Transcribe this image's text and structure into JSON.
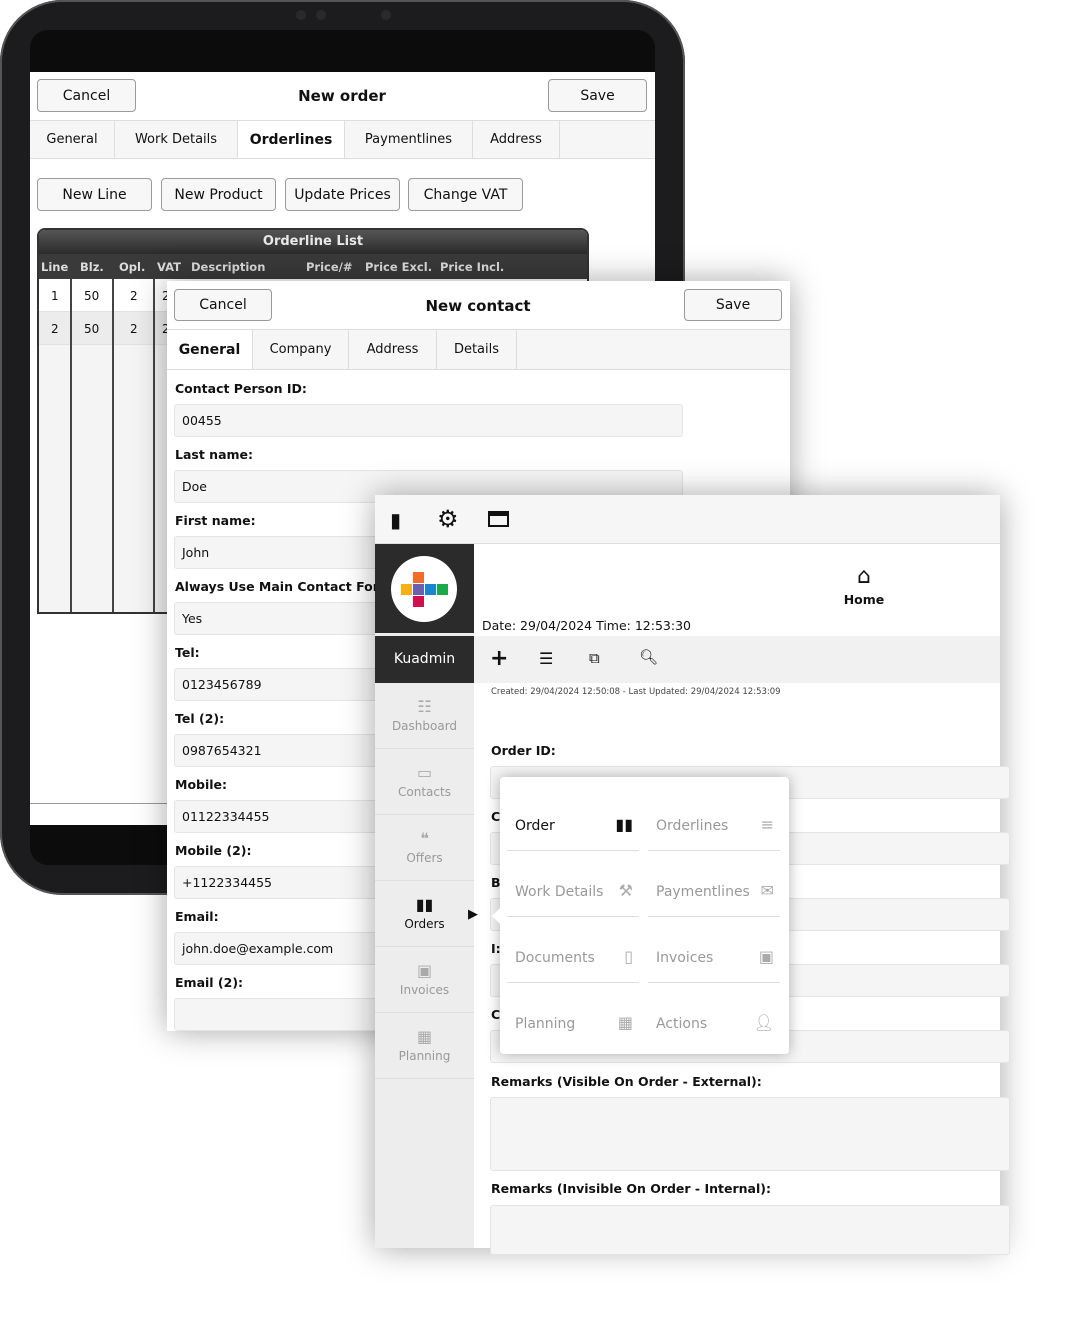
{
  "order": {
    "cancel": "Cancel",
    "title": "New order",
    "save": "Save",
    "tabs": [
      "General",
      "Work Details",
      "Orderlines",
      "Paymentlines",
      "Address"
    ],
    "active_tab": "Orderlines",
    "actions": [
      "New Line",
      "New Product",
      "Update Prices",
      "Change VAT"
    ],
    "table": {
      "title": "Orderline List",
      "columns": [
        "Line",
        "Blz.",
        "Opl.",
        "VAT",
        "Description",
        "Price/#",
        "Price Excl.",
        "Price Incl."
      ],
      "rows": [
        [
          "1",
          "50",
          "2",
          "2"
        ],
        [
          "2",
          "50",
          "2",
          "2"
        ]
      ]
    }
  },
  "contact": {
    "cancel": "Cancel",
    "title": "New contact",
    "save": "Save",
    "tabs": [
      "General",
      "Company",
      "Address",
      "Details"
    ],
    "active_tab": "General",
    "fields": [
      {
        "label": "Contact Person ID:",
        "value": "00455"
      },
      {
        "label": "Last name:",
        "value": "Doe"
      },
      {
        "label": "First name:",
        "value": "John"
      },
      {
        "label": "Always Use Main Contact For O",
        "value": "Yes"
      },
      {
        "label": "Tel:",
        "value": "0123456789"
      },
      {
        "label": "Tel (2):",
        "value": "0987654321"
      },
      {
        "label": "Mobile:",
        "value": "01122334455"
      },
      {
        "label": "Mobile (2):",
        "value": "+1122334455"
      },
      {
        "label": "Email:",
        "value": "john.doe@example.com"
      },
      {
        "label": "Email (2):",
        "value": ""
      }
    ]
  },
  "app": {
    "user": "Kuadmin",
    "home": "Home",
    "datetime": "Date: 29/04/2024 Time: 12:53:30",
    "meta": "Created: 29/04/2024 12:50:08 - Last Updated: 29/04/2024 12:53:09",
    "sidebar": [
      {
        "label": "Dashboard",
        "icon": "list-icon"
      },
      {
        "label": "Contacts",
        "icon": "id-card-icon"
      },
      {
        "label": "Offers",
        "icon": "quote-icon"
      },
      {
        "label": "Orders",
        "icon": "orders-icon",
        "active": true
      },
      {
        "label": "Invoices",
        "icon": "invoice-icon"
      },
      {
        "label": "Planning",
        "icon": "calendar-icon"
      }
    ],
    "labels": [
      "Order ID:",
      "C",
      "B",
      "I:",
      "C"
    ],
    "remarks_external": "Remarks (Visible On Order - External):",
    "remarks_internal": "Remarks (Invisible On Order - Internal):",
    "menu": [
      {
        "label": "Order",
        "icon": "orders-icon",
        "active": true
      },
      {
        "label": "Orderlines",
        "icon": "lines-icon"
      },
      {
        "label": "Work Details",
        "icon": "worker-icon"
      },
      {
        "label": "Paymentlines",
        "icon": "payment-icon"
      },
      {
        "label": "Documents",
        "icon": "document-icon"
      },
      {
        "label": "Invoices",
        "icon": "invoice-icon"
      },
      {
        "label": "Planning",
        "icon": "calendar-icon"
      },
      {
        "label": "Actions",
        "icon": "user-gear-icon"
      }
    ]
  },
  "colors": {
    "dark": "#2b2b2b",
    "logo": [
      "#f26b2a",
      "#f5b016",
      "#6a5fb0",
      "#1a86d0",
      "#1aaa4a",
      "#d0104c"
    ]
  }
}
